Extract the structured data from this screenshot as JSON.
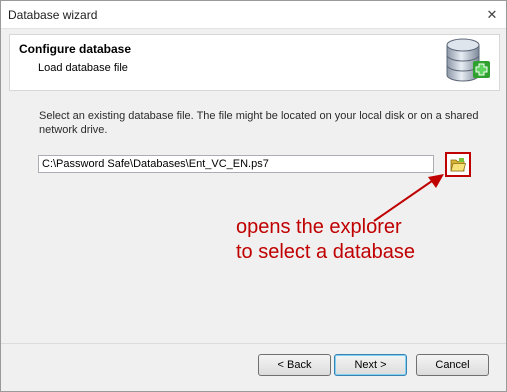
{
  "window": {
    "title": "Database wizard",
    "close_glyph": "✕"
  },
  "header": {
    "title": "Configure database",
    "subtitle": "Load database file",
    "icon": "database-add-icon"
  },
  "main": {
    "description": "Select an existing database file. The file might be located on your local disk or on a shared network drive.",
    "path_value": "C:\\Password Safe\\Databases\\Ent_VC_EN.ps7",
    "browse_icon": "folder-open-icon"
  },
  "annotation": {
    "line1": "opens the explorer",
    "line2": "to select a database",
    "color": "#c00000"
  },
  "footer": {
    "back_label": "< Back",
    "next_label": "Next >",
    "cancel_label": "Cancel"
  }
}
